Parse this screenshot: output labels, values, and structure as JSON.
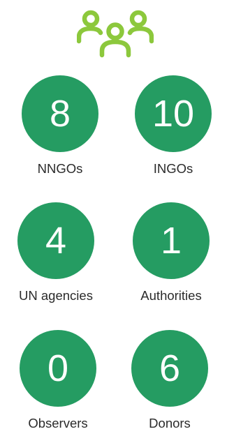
{
  "colors": {
    "circle": "#259c62",
    "icon": "#8cc83c",
    "label_text": "#2b2b2b"
  },
  "header": {
    "icon": "people-group-icon"
  },
  "stats": [
    {
      "value": "8",
      "label": "NNGOs"
    },
    {
      "value": "10",
      "label": "INGOs"
    },
    {
      "value": "4",
      "label": "UN agencies"
    },
    {
      "value": "1",
      "label": "Authorities"
    },
    {
      "value": "0",
      "label": "Observers"
    },
    {
      "value": "6",
      "label": "Donors"
    }
  ]
}
